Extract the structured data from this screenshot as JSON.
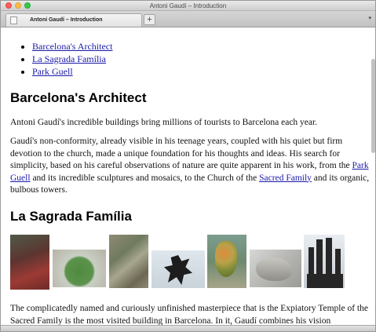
{
  "window": {
    "title": "Antoni Gaudí – Introduction"
  },
  "tabs": [
    {
      "label": "Antoni Gaudí – Introduction"
    }
  ],
  "tabbar": {
    "new_tab_label": "+",
    "more_icon": "chevron-down-icon"
  },
  "toc": [
    {
      "label": "Barcelona's Architect"
    },
    {
      "label": "La Sagrada Família"
    },
    {
      "label": "Park Guell"
    }
  ],
  "section1": {
    "heading": "Barcelona's Architect",
    "p1": "Antoni Gaudí's incredible buildings bring millions of tourists to Barcelona each year.",
    "p2_a": "Gaudí's non-conformity, already visible in his teenage years, coupled with his quiet but firm devotion to the church, made a unique foundation for his thoughts and ideas. His search for simplicity, based on his careful observations of nature are quite apparent in his work, from the ",
    "p2_link1": "Park Guell",
    "p2_b": " and its incredible sculptures and mosaics, to the Church of the ",
    "p2_link2": "Sacred Family",
    "p2_c": " and its organic, bulbous towers."
  },
  "section2": {
    "heading": "La Sagrada Família",
    "p1": "The complicatedly named and curiously unfinished masterpiece that is the Expiatory Temple of the Sacred Family is the most visited building in Barcelona. In it, Gaudí combines his vision"
  },
  "colors": {
    "link": "#1a1aa8",
    "close": "#fc605c",
    "minimize": "#fdbc40",
    "maximize": "#34c84a"
  }
}
